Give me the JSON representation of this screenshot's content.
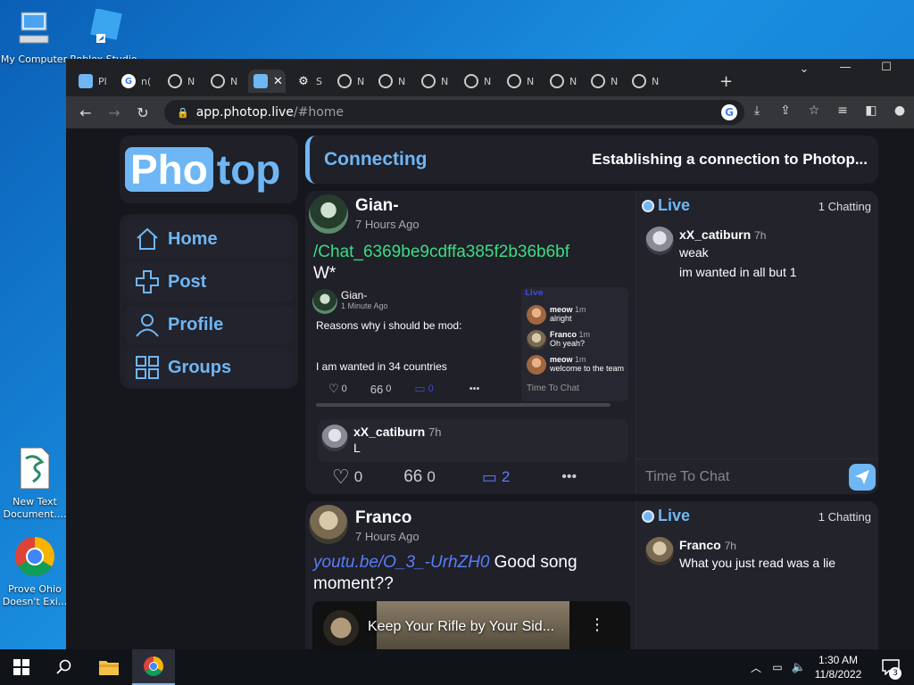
{
  "desktop": {
    "icons": [
      {
        "label": "My Computer"
      },
      {
        "label": "Roblox Studio"
      },
      {
        "label": "New Text Document...."
      },
      {
        "label": "Prove Ohio Doesn't Exi..."
      }
    ]
  },
  "browser": {
    "tabs": [
      {
        "short": "Pl"
      },
      {
        "short": "n("
      },
      {
        "short": "N"
      },
      {
        "short": "N"
      },
      {
        "short": ""
      },
      {
        "short": "S"
      },
      {
        "short": "N"
      },
      {
        "short": "N"
      },
      {
        "short": "N"
      },
      {
        "short": "N"
      },
      {
        "short": "N"
      },
      {
        "short": "N"
      },
      {
        "short": "N"
      },
      {
        "short": "N"
      }
    ],
    "new_tab": "+",
    "url_host": "app.photop.live",
    "url_path": "/#home"
  },
  "app": {
    "logo_left": "Pho",
    "logo_right": "top",
    "nav": [
      {
        "label": "Home"
      },
      {
        "label": "Post"
      },
      {
        "label": "Profile"
      },
      {
        "label": "Groups"
      }
    ],
    "status": {
      "state": "Connecting",
      "message": "Establishing a connection to Photop..."
    },
    "posts": [
      {
        "author": "Gian-",
        "time": "7 Hours Ago",
        "link": "/Chat_6369be9cdffa385f2b36b6bf",
        "text": "W*",
        "quoted": {
          "author": "Gian-",
          "time": "1 Minute Ago",
          "line1": "Reasons why i should be mod:",
          "line2": "I am wanted in 34 countries",
          "likes": "0",
          "quotes": "0",
          "comments": "0",
          "mini_live": "Live",
          "mini_chat": [
            {
              "user": "meow",
              "time": "1m",
              "text": "alright"
            },
            {
              "user": "Franco",
              "time": "1m",
              "text": "Oh yeah?"
            },
            {
              "user": "meow",
              "time": "1m",
              "text": "welcome to the team"
            }
          ],
          "mini_input": "Time To Chat"
        },
        "reply": {
          "user": "xX_catiburn",
          "time": "7h",
          "text": "L"
        },
        "likes": "0",
        "quotes": "0",
        "comments": "2",
        "chat": {
          "live": "Live",
          "chatting": "1 Chatting",
          "messages": [
            {
              "user": "xX_catiburn",
              "time": "7h",
              "lines": [
                "weak",
                "im wanted in all but 1"
              ]
            }
          ],
          "input_placeholder": "Time To Chat"
        }
      },
      {
        "author": "Franco",
        "time": "7 Hours Ago",
        "link": "youtu.be/O_3_-UrhZH0",
        "text": "Good song",
        "text2": "moment??",
        "video_title": "Keep Your Rifle by Your Sid...",
        "chat": {
          "live": "Live",
          "chatting": "1 Chatting",
          "messages": [
            {
              "user": "Franco",
              "time": "7h",
              "lines": [
                "What you just read was a lie"
              ]
            }
          ]
        }
      }
    ]
  },
  "taskbar": {
    "time": "1:30 AM",
    "date": "11/8/2022",
    "notifications": "3"
  },
  "colors": {
    "accent": "#6fb6f5",
    "link_green": "#3ddc84",
    "link_blue": "#5a7dfa",
    "bg": "#16171d",
    "panel": "#1f2028"
  }
}
